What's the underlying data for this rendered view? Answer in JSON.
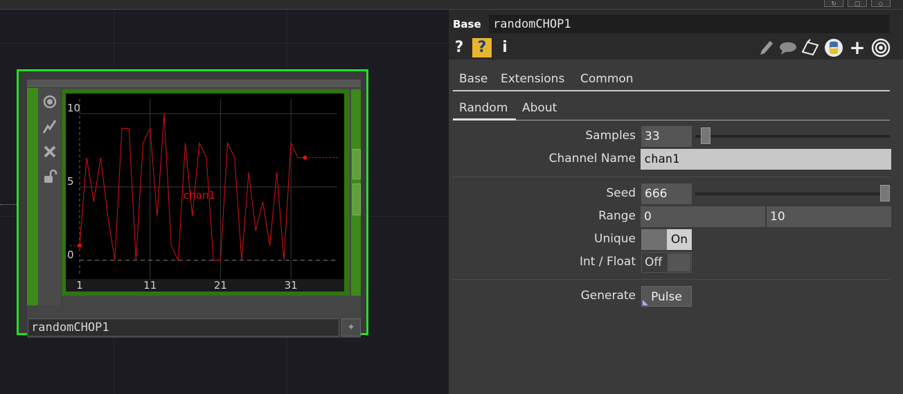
{
  "network": {
    "node_name": "randomCHOP1",
    "chart_data": {
      "type": "line",
      "channel": "chan1",
      "x": [
        0,
        1,
        2,
        3,
        4,
        5,
        6,
        7,
        8,
        9,
        10,
        11,
        12,
        13,
        14,
        15,
        16,
        17,
        18,
        19,
        20,
        21,
        22,
        23,
        24,
        25,
        26,
        27,
        28,
        29,
        30,
        31,
        32
      ],
      "values": [
        1,
        7,
        4,
        7,
        3,
        0,
        9,
        9,
        0,
        8,
        9,
        3,
        10,
        1,
        0,
        8,
        3,
        8,
        7,
        0,
        0,
        8,
        7,
        0,
        6,
        2,
        4,
        1,
        6,
        0,
        8,
        7,
        7
      ],
      "xticks": [
        "1",
        "11",
        "21",
        "31"
      ],
      "yticks": [
        "0",
        "5",
        "10"
      ],
      "ylim": [
        -1,
        11
      ]
    }
  },
  "panel": {
    "op_type": "Base",
    "op_name": "randomCHOP1",
    "toolbar_icons": [
      "help-icon",
      "help-context-icon",
      "info-icon",
      "edit-icon",
      "comment-icon",
      "clone-icon",
      "python-icon",
      "add-icon",
      "target-icon"
    ],
    "tools": {
      "help": "?",
      "help_ctx": "?",
      "info": "i",
      "add": "+"
    },
    "page_tabs": [
      "Base",
      "Extensions",
      "Common"
    ],
    "sub_tabs": [
      "Random",
      "About"
    ],
    "params": {
      "samples_label": "Samples",
      "samples_value": "33",
      "samples_fraction": 0.03,
      "channel_label": "Channel Name",
      "channel_value": "chan1",
      "seed_label": "Seed",
      "seed_value": "666",
      "seed_fraction": 1.0,
      "range_label": "Range",
      "range_min": "0",
      "range_max": "10",
      "unique_label": "Unique",
      "unique_value": "On",
      "intfloat_label": "Int / Float",
      "intfloat_value": "Off",
      "generate_label": "Generate",
      "generate_value": "Pulse"
    }
  },
  "colors": {
    "node_outline": "#24e024",
    "chan_line": "#dd1111",
    "panel_bg": "#3a3a3a"
  }
}
